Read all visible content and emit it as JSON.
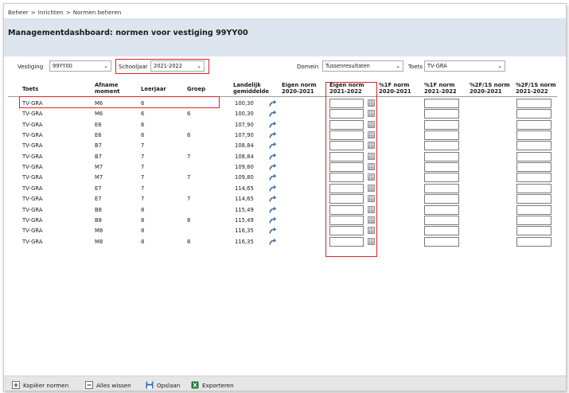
{
  "breadcrumb": [
    "Beheer",
    "Inrichten",
    "Normen beheren"
  ],
  "breadcrumb_sep": ">",
  "page_title": "Managementdashboard: normen voor vestiging 99YY00",
  "filters": {
    "vestiging_label": "Vestiging",
    "vestiging_value": "99YY00",
    "schooljaar_label": "Schooljaar",
    "schooljaar_value": "2021-2022",
    "domein_label": "Domein",
    "domein_value": "Tussenresultaten",
    "toets_label": "Toets",
    "toets_value": "TV-GRA"
  },
  "columns": {
    "toets": "Toets",
    "afname_1": "Afname",
    "afname_2": "moment",
    "leerjaar": "Leerjaar",
    "groep": "Groep",
    "landelijk_1": "Landelijk",
    "landelijk_2": "gemiddelde",
    "eigen20_1": "Eigen norm",
    "eigen20_2": "2020-2021",
    "eigen21_1": "Eigen norm",
    "eigen21_2": "2021-2022",
    "f1_20_1": "%1F norm",
    "f1_20_2": "2020-2021",
    "f1_21_1": "%1F norm",
    "f1_21_2": "2021-2022",
    "f2_20_1": "%2F/1S norm",
    "f2_20_2": "2020-2021",
    "f2_21_1": "%2F/1S norm",
    "f2_21_2": "2021-2022"
  },
  "rows": [
    {
      "toets": "TV-GRA",
      "moment": "M6",
      "leerjaar": "6",
      "groep": "",
      "landelijk": "100,30"
    },
    {
      "toets": "TV-GRA",
      "moment": "M6",
      "leerjaar": "6",
      "groep": "6",
      "landelijk": "100,30"
    },
    {
      "toets": "TV-GRA",
      "moment": "E6",
      "leerjaar": "6",
      "groep": "",
      "landelijk": "107,90"
    },
    {
      "toets": "TV-GRA",
      "moment": "E6",
      "leerjaar": "6",
      "groep": "6",
      "landelijk": "107,90"
    },
    {
      "toets": "TV-GRA",
      "moment": "B7",
      "leerjaar": "7",
      "groep": "",
      "landelijk": "108,84"
    },
    {
      "toets": "TV-GRA",
      "moment": "B7",
      "leerjaar": "7",
      "groep": "7",
      "landelijk": "108,84"
    },
    {
      "toets": "TV-GRA",
      "moment": "M7",
      "leerjaar": "7",
      "groep": "",
      "landelijk": "109,80"
    },
    {
      "toets": "TV-GRA",
      "moment": "M7",
      "leerjaar": "7",
      "groep": "7",
      "landelijk": "109,80"
    },
    {
      "toets": "TV-GRA",
      "moment": "E7",
      "leerjaar": "7",
      "groep": "",
      "landelijk": "114,65"
    },
    {
      "toets": "TV-GRA",
      "moment": "E7",
      "leerjaar": "7",
      "groep": "7",
      "landelijk": "114,65"
    },
    {
      "toets": "TV-GRA",
      "moment": "B8",
      "leerjaar": "8",
      "groep": "",
      "landelijk": "115,49"
    },
    {
      "toets": "TV-GRA",
      "moment": "B8",
      "leerjaar": "8",
      "groep": "8",
      "landelijk": "115,49"
    },
    {
      "toets": "TV-GRA",
      "moment": "M8",
      "leerjaar": "8",
      "groep": "",
      "landelijk": "116,35"
    },
    {
      "toets": "TV-GRA",
      "moment": "M8",
      "leerjaar": "8",
      "groep": "8",
      "landelijk": "116,35"
    }
  ],
  "actions": {
    "kopieer": "Kopiëer normen",
    "wissen": "Alles wissen",
    "opslaan": "Opslaan",
    "exporteren": "Exporteren"
  },
  "icons": {
    "copy_arrow": "curved-arrow-icon",
    "calculator": "calculator-icon",
    "add": "plus-icon",
    "clear": "minus-icon",
    "save": "floppy-disk-icon",
    "export": "excel-icon"
  },
  "colors": {
    "highlight": "#e0202a",
    "title_bar": "#dde6ee",
    "arrow": "#4a6fa5",
    "excel": "#1f7a3a"
  }
}
